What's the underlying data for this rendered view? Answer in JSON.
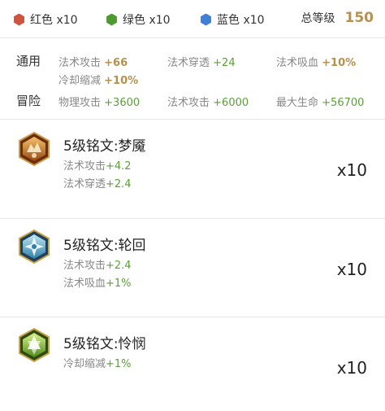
{
  "colors": {
    "red": "#d0533f",
    "green": "#4f9a2e",
    "blue": "#3f7fd6",
    "gold": "#b8904d",
    "stat_green": "#5aa035"
  },
  "gems": [
    {
      "label": "红色 x10",
      "color": "#d0533f"
    },
    {
      "label": "绿色 x10",
      "color": "#4f9a2e"
    },
    {
      "label": "蓝色 x10",
      "color": "#3f7fd6"
    }
  ],
  "total": {
    "label": "总等级",
    "value": "150"
  },
  "general": {
    "label": "通用",
    "stats": [
      {
        "name": "法术攻击",
        "value": "+66"
      },
      {
        "name": "法术穿透",
        "value": "+24"
      },
      {
        "name": "法术吸血",
        "value": "+10%"
      },
      {
        "name": "冷却缩减",
        "value": "+10%"
      }
    ]
  },
  "adventure": {
    "label": "冒险",
    "stats": [
      {
        "name": "物理攻击",
        "value": "+3600"
      },
      {
        "name": "法术攻击",
        "value": "+6000"
      },
      {
        "name": "最大生命",
        "value": "+56700"
      }
    ]
  },
  "runes": [
    {
      "name": "5级铭文:梦魇",
      "icon": "nightmare-rune-icon",
      "count": "x10",
      "attrs": [
        {
          "name": "法术攻击",
          "value": "+4.2"
        },
        {
          "name": "法术穿透",
          "value": "+2.4"
        }
      ]
    },
    {
      "name": "5级铭文:轮回",
      "icon": "samsara-rune-icon",
      "count": "x10",
      "attrs": [
        {
          "name": "法术攻击",
          "value": "+2.4"
        },
        {
          "name": "法术吸血",
          "value": "+1%"
        }
      ]
    },
    {
      "name": "5级铭文:怜悯",
      "icon": "mercy-rune-icon",
      "count": "x10",
      "attrs": [
        {
          "name": "冷却缩减",
          "value": "+1%"
        }
      ]
    }
  ]
}
